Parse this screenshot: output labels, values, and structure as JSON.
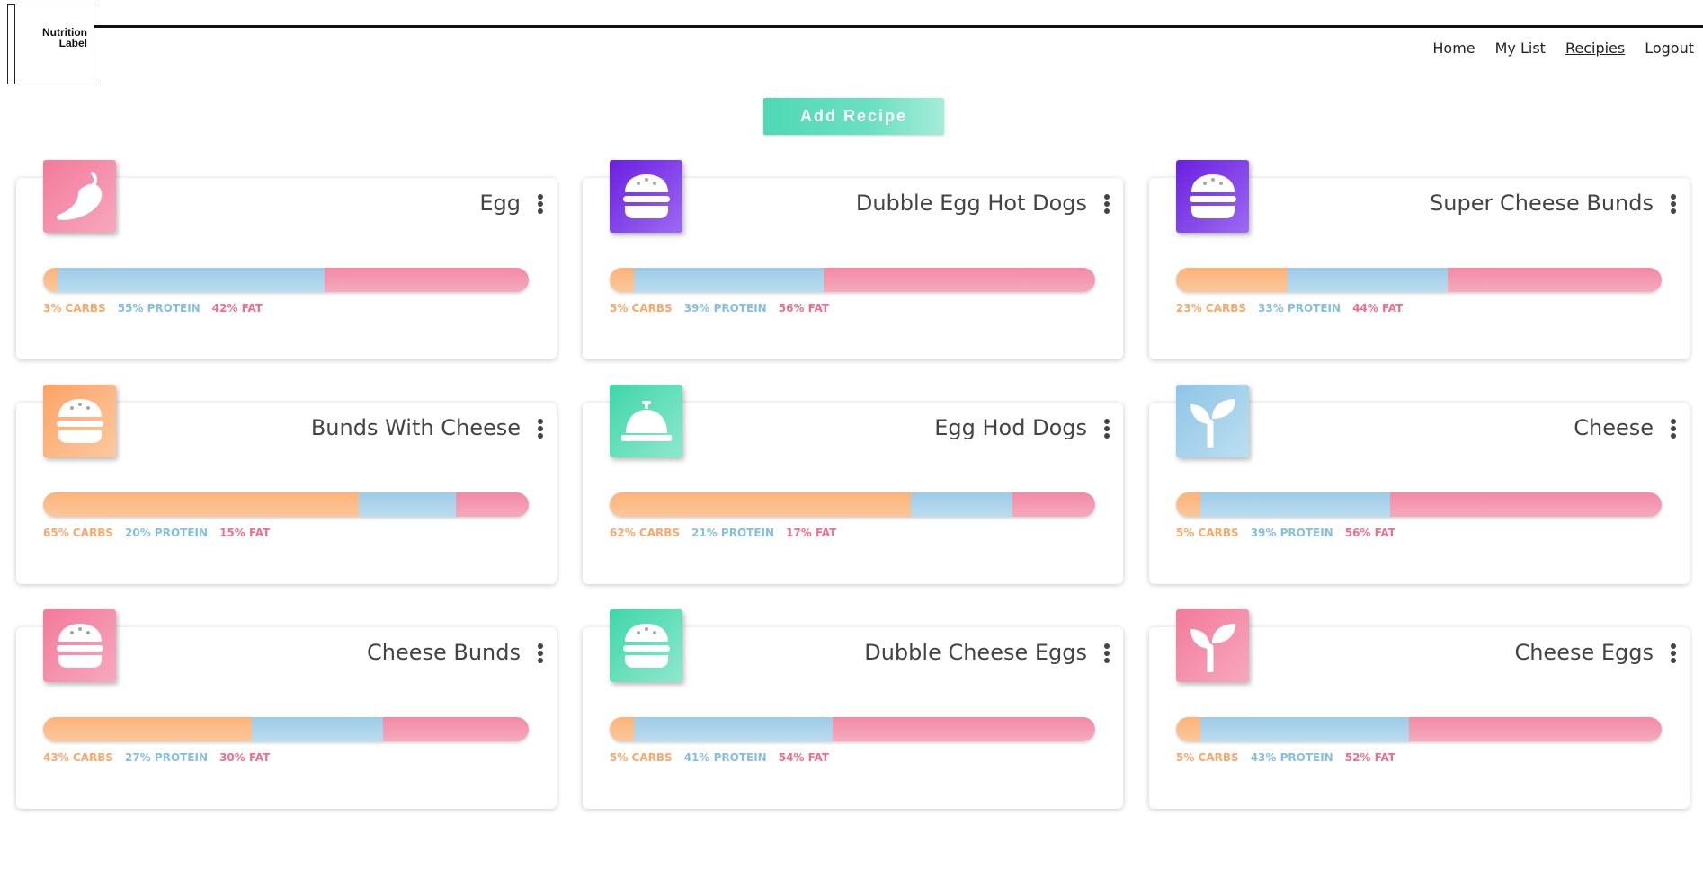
{
  "header": {
    "logo_line1": "Nutrition",
    "logo_line2": "Label",
    "nav": [
      {
        "label": "Home",
        "active": false
      },
      {
        "label": "My List",
        "active": false
      },
      {
        "label": "Recipies",
        "active": true
      },
      {
        "label": "Logout",
        "active": false
      }
    ]
  },
  "add_button_label": "Add Recipe",
  "colors": {
    "carbs": "#f8a86a",
    "protein": "#84bfe0",
    "fat": "#ef6d8f",
    "accent_teal": "#4fd8b4"
  },
  "recipes": [
    {
      "title": "Egg",
      "icon": "pepper-icon",
      "icon_bg": "pink",
      "carbs": 3,
      "protein": 55,
      "fat": 42,
      "carbs_label": "3% CARBS",
      "protein_label": "55% PROTEIN",
      "fat_label": "42% FAT"
    },
    {
      "title": "Dubble Egg Hot Dogs",
      "icon": "hamburger-icon",
      "icon_bg": "purple",
      "carbs": 5,
      "protein": 39,
      "fat": 56,
      "carbs_label": "5% CARBS",
      "protein_label": "39% PROTEIN",
      "fat_label": "56% FAT"
    },
    {
      "title": "Super Cheese Bunds",
      "icon": "hamburger-icon",
      "icon_bg": "purple",
      "carbs": 23,
      "protein": 33,
      "fat": 44,
      "carbs_label": "23% CARBS",
      "protein_label": "33% PROTEIN",
      "fat_label": "44% FAT"
    },
    {
      "title": "Bunds With Cheese",
      "icon": "hamburger-icon",
      "icon_bg": "orange",
      "carbs": 65,
      "protein": 20,
      "fat": 15,
      "carbs_label": "65% CARBS",
      "protein_label": "20% PROTEIN",
      "fat_label": "15% FAT"
    },
    {
      "title": "Egg Hod Dogs",
      "icon": "concierge-bell-icon",
      "icon_bg": "teal",
      "carbs": 62,
      "protein": 21,
      "fat": 17,
      "carbs_label": "62% CARBS",
      "protein_label": "21% PROTEIN",
      "fat_label": "17% FAT"
    },
    {
      "title": "Cheese",
      "icon": "seedling-icon",
      "icon_bg": "blue",
      "carbs": 5,
      "protein": 39,
      "fat": 56,
      "carbs_label": "5% CARBS",
      "protein_label": "39% PROTEIN",
      "fat_label": "56% FAT"
    },
    {
      "title": "Cheese Bunds",
      "icon": "hamburger-icon",
      "icon_bg": "pink",
      "carbs": 43,
      "protein": 27,
      "fat": 30,
      "carbs_label": "43% CARBS",
      "protein_label": "27% PROTEIN",
      "fat_label": "30% FAT"
    },
    {
      "title": "Dubble Cheese Eggs",
      "icon": "hamburger-icon",
      "icon_bg": "teal",
      "carbs": 5,
      "protein": 41,
      "fat": 54,
      "carbs_label": "5% CARBS",
      "protein_label": "41% PROTEIN",
      "fat_label": "54% FAT"
    },
    {
      "title": "Cheese Eggs",
      "icon": "seedling-icon",
      "icon_bg": "pink",
      "carbs": 5,
      "protein": 43,
      "fat": 52,
      "carbs_label": "5% CARBS",
      "protein_label": "43% PROTEIN",
      "fat_label": "52% FAT"
    }
  ]
}
